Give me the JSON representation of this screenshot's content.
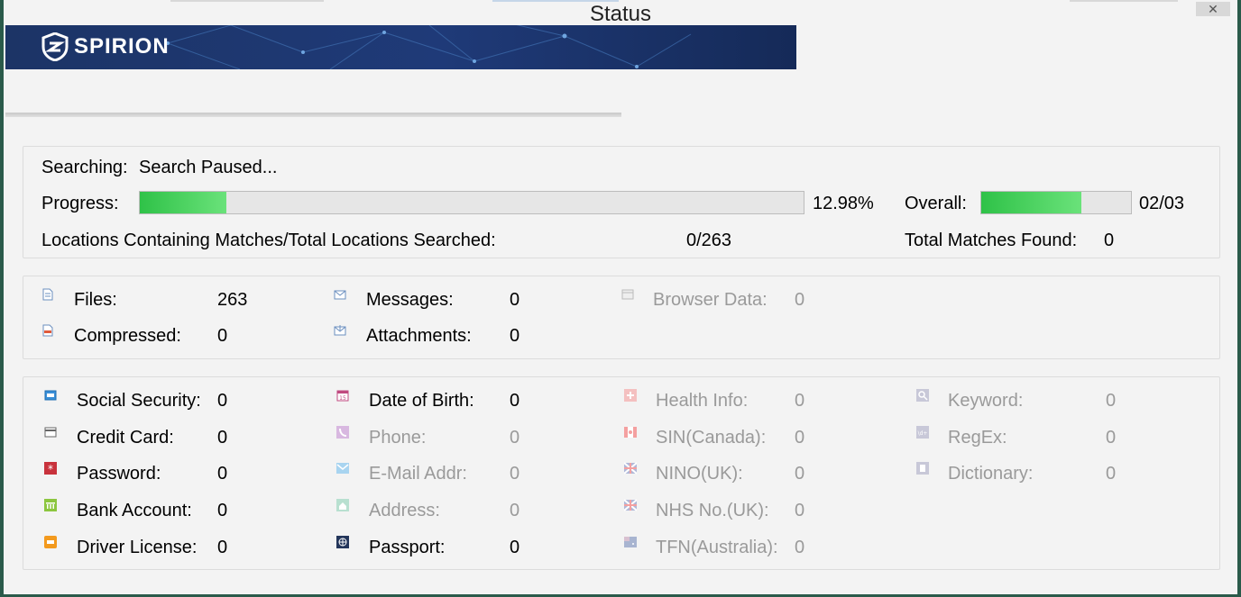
{
  "window": {
    "title": "Status",
    "close_glyph": "✕"
  },
  "brand": {
    "name": "SPIRION",
    "icon": "spirion-shield-icon",
    "banner_color": "#1f3a78"
  },
  "status": {
    "searching_label": "Searching:",
    "searching_value": "Search Paused...",
    "progress_label": "Progress:",
    "progress_value": 0.1298,
    "progress_text": "12.98%",
    "overall_label": "Overall:",
    "overall_value": 0.6667,
    "overall_text": "02/03",
    "locations_label": "Locations Containing Matches/Total Locations Searched:",
    "locations_value": "0/263",
    "total_matches_label": "Total Matches Found:",
    "total_matches_value": "0",
    "progress_color": "#3ccc55"
  },
  "sources": [
    {
      "label": "Files:",
      "value": "263",
      "icon": "file-icon",
      "enabled": true
    },
    {
      "label": "Compressed:",
      "value": "0",
      "icon": "compressed-file-icon",
      "enabled": true
    },
    {
      "label": "Messages:",
      "value": "0",
      "icon": "envelope-icon",
      "enabled": true
    },
    {
      "label": "Attachments:",
      "value": "0",
      "icon": "attachment-envelope-icon",
      "enabled": true
    },
    {
      "label": "Browser Data:",
      "value": "0",
      "icon": "browser-data-icon",
      "enabled": false
    }
  ],
  "types": [
    {
      "label": "Social Security:",
      "value": "0",
      "icon": "id-card-icon",
      "enabled": true
    },
    {
      "label": "Credit Card:",
      "value": "0",
      "icon": "credit-card-icon",
      "enabled": true
    },
    {
      "label": "Password:",
      "value": "0",
      "icon": "asterisk-icon",
      "enabled": true
    },
    {
      "label": "Bank Account:",
      "value": "0",
      "icon": "bank-icon",
      "enabled": true
    },
    {
      "label": "Driver License:",
      "value": "0",
      "icon": "car-icon",
      "enabled": true
    },
    {
      "label": "Date of Birth:",
      "value": "0",
      "icon": "calendar-icon",
      "enabled": true
    },
    {
      "label": "Phone:",
      "value": "0",
      "icon": "phone-icon",
      "enabled": false
    },
    {
      "label": "E-Mail Addr:",
      "value": "0",
      "icon": "mail-icon",
      "enabled": false
    },
    {
      "label": "Address:",
      "value": "0",
      "icon": "house-icon",
      "enabled": false
    },
    {
      "label": "Passport:",
      "value": "0",
      "icon": "globe-icon",
      "enabled": true
    },
    {
      "label": "Health Info:",
      "value": "0",
      "icon": "health-cross-icon",
      "enabled": false
    },
    {
      "label": "SIN(Canada):",
      "value": "0",
      "icon": "canada-flag-icon",
      "enabled": false
    },
    {
      "label": "NINO(UK):",
      "value": "0",
      "icon": "uk-flag-icon",
      "enabled": false
    },
    {
      "label": "NHS No.(UK):",
      "value": "0",
      "icon": "uk-flag-icon",
      "enabled": false
    },
    {
      "label": "TFN(Australia):",
      "value": "0",
      "icon": "australia-flag-icon",
      "enabled": false
    },
    {
      "label": "Keyword:",
      "value": "0",
      "icon": "magnifier-icon",
      "enabled": false
    },
    {
      "label": "RegEx:",
      "value": "0",
      "icon": "regex-icon",
      "enabled": false
    },
    {
      "label": "Dictionary:",
      "value": "0",
      "icon": "dictionary-icon",
      "enabled": false
    }
  ]
}
